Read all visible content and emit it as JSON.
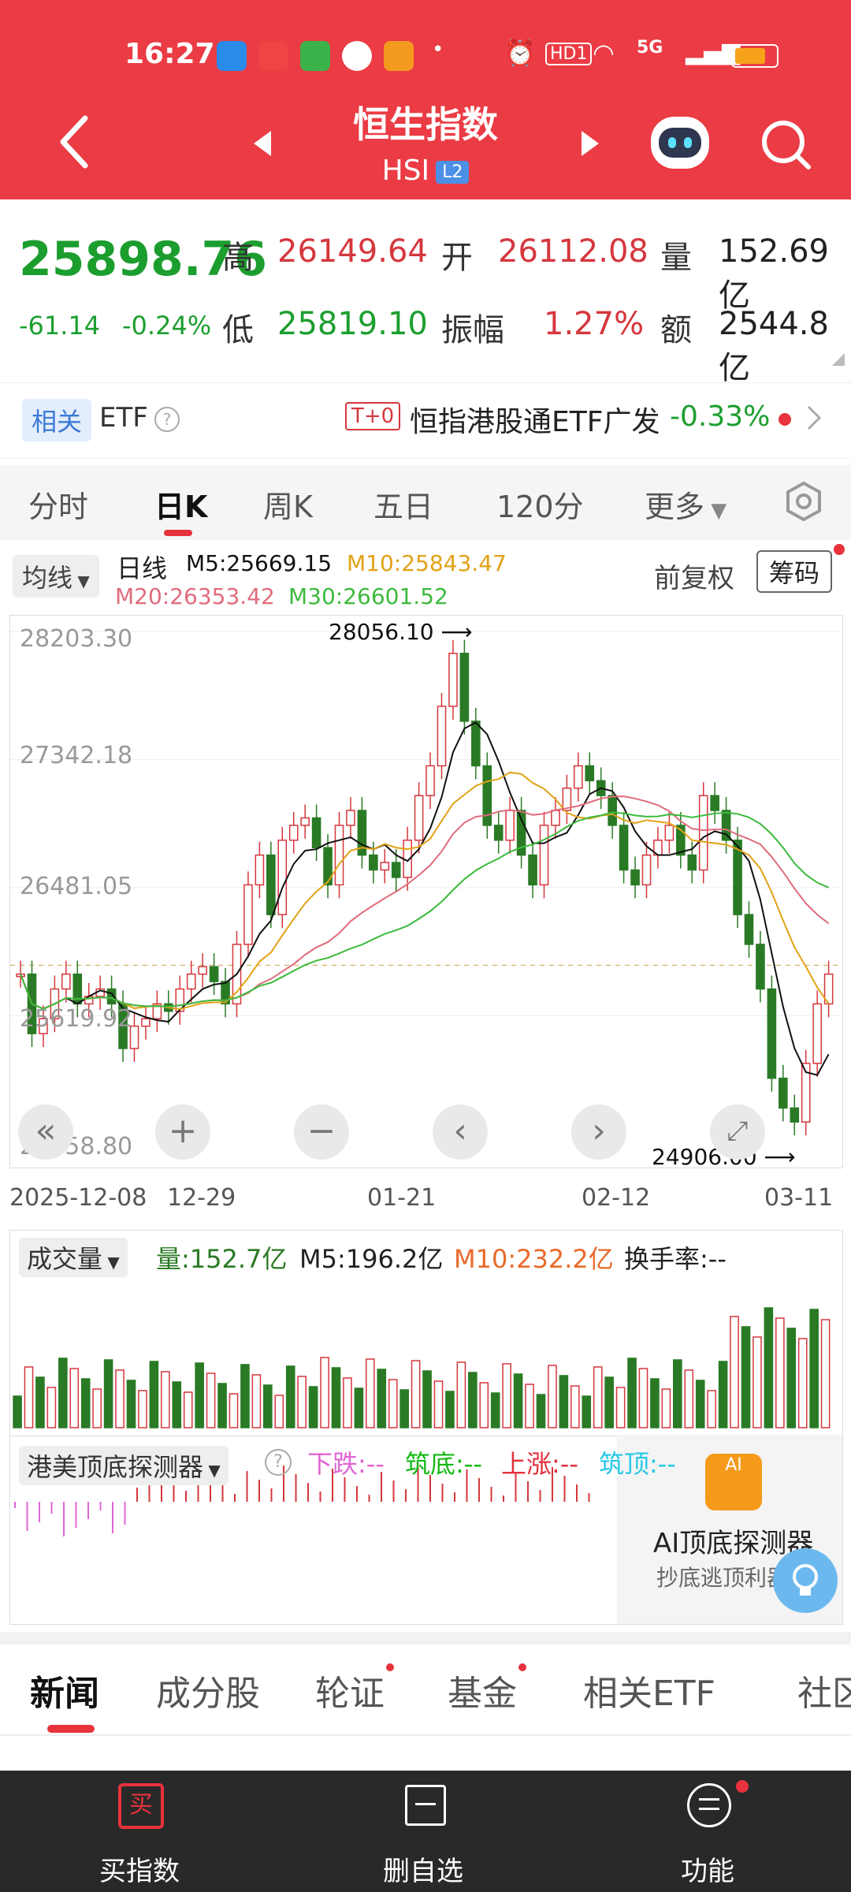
{
  "status_bar": {
    "time": "16:27",
    "network": "5G",
    "hd": "HD1"
  },
  "header": {
    "title": "恒生指数",
    "subtitle": "HSI",
    "badge": "L2"
  },
  "quote": {
    "price": "25898.76",
    "change": "-61.14",
    "change_pct": "-0.24%",
    "high_label": "高",
    "high": "26149.64",
    "low_label": "低",
    "low": "25819.10",
    "open_label": "开",
    "open": "26112.08",
    "amplitude_label": "振幅",
    "amplitude": "1.27%",
    "volume_label": "量",
    "volume": "152.69亿",
    "amount_label": "额",
    "amount": "2544.8亿"
  },
  "etf_bar": {
    "tag": "相关",
    "label": "ETF",
    "t0": "T+0",
    "fund_name": "恒指港股通ETF广发",
    "fund_change": "-0.33%"
  },
  "tabs": [
    "分时",
    "日K",
    "周K",
    "五日",
    "120分",
    "更多"
  ],
  "chart_header": {
    "ma_button": "均线",
    "period": "日线",
    "m5": "M5:25669.15",
    "m10": "M10:25843.47",
    "m20": "M20:26353.42",
    "m30": "M30:26601.52",
    "adjust": "前复权",
    "chips": "筹码"
  },
  "chart_labels": {
    "y_ticks": [
      "28203.30",
      "27342.18",
      "26481.05",
      "25619.92",
      "24758.80"
    ],
    "high_marker": "28056.10",
    "low_marker": "24906.00",
    "x_ticks": [
      "2025-12-08",
      "12-29",
      "01-21",
      "02-12",
      "03-11"
    ]
  },
  "volume_header": {
    "button": "成交量",
    "vol": "量:152.7亿",
    "m5": "M5:196.2亿",
    "m10": "M10:232.2亿",
    "turnover": "换手率:--"
  },
  "detector": {
    "button": "港美顶底探测器",
    "down": "下跌:--",
    "bottom": "筑底:--",
    "up": "上涨:--",
    "top": "筑顶:--",
    "ai_title": "AI顶底探测器",
    "ai_sub": "抄底逃顶利器"
  },
  "news_tabs": [
    "新闻",
    "成分股",
    "轮证",
    "基金",
    "相关ETF",
    "社区"
  ],
  "bottom_nav": [
    "买指数",
    "删自选",
    "功能"
  ],
  "colors": {
    "accent": "#eb3b44",
    "up": "#d5373d",
    "down": "#1c9e2f"
  },
  "chart_data": {
    "type": "candlestick",
    "ylim": [
      24758.8,
      28203.3
    ],
    "high": 28056.1,
    "low": 24906.0,
    "ma": {
      "M5": 25669.15,
      "M10": 25843.47,
      "M20": 26353.42,
      "M30": 26601.52
    }
  }
}
